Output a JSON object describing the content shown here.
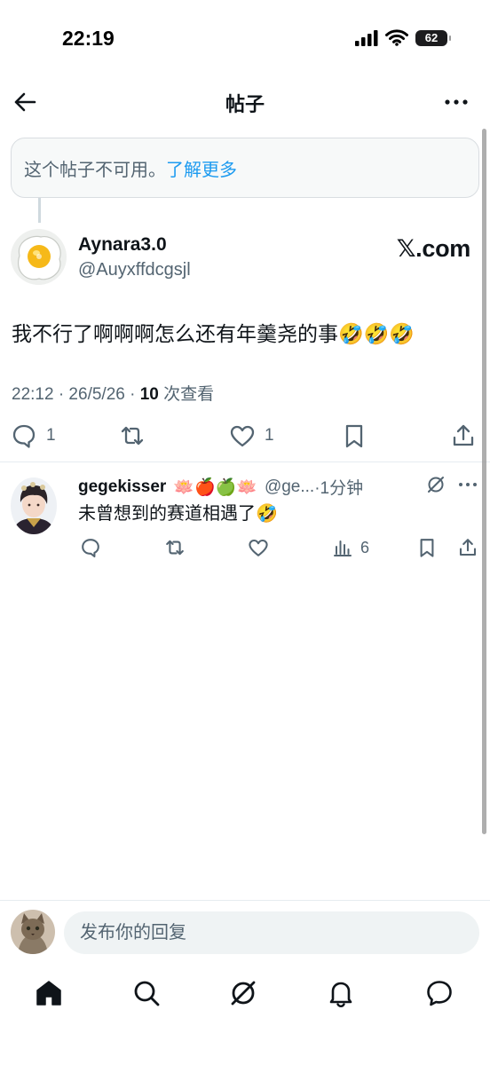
{
  "status_bar": {
    "time": "22:19",
    "battery": "62"
  },
  "header": {
    "title": "帖子"
  },
  "notice": {
    "text": "这个帖子不可用。",
    "link": "了解更多"
  },
  "tweet": {
    "author_name": "Aynara3.0",
    "author_handle": "@Auyxffdcgsjl",
    "watermark": "𝕏.com",
    "text": "我不行了啊啊啊怎么还有年羹尧的事🤣🤣🤣",
    "meta_time": "22:12 · 26/5/26 · ",
    "meta_views_count": "10",
    "meta_views_label": " 次查看",
    "replies": "1",
    "likes": "1"
  },
  "reply": {
    "name": "gegekisser",
    "emojis": "🪷🍎🍏🪷",
    "handle": "@ge...",
    "time": "·1分钟",
    "text": "未曾想到的赛道相遇了🤣",
    "views": "6"
  },
  "compose": {
    "placeholder": "发布你的回复"
  },
  "colors": {
    "accent": "#1d9bf0",
    "text": "#0f1419",
    "muted": "#536471",
    "border": "#e6ecf0"
  },
  "icons": {
    "back": "arrow-left-icon",
    "more": "more-horizontal-icon",
    "reply": "comment-icon",
    "retweet": "retweet-icon",
    "like": "heart-icon",
    "bookmark": "bookmark-icon",
    "share": "share-icon",
    "views": "bar-chart-icon",
    "grok": "grok-icon",
    "nav": [
      "home-icon",
      "search-icon",
      "grok-icon",
      "bell-icon",
      "message-icon"
    ]
  }
}
